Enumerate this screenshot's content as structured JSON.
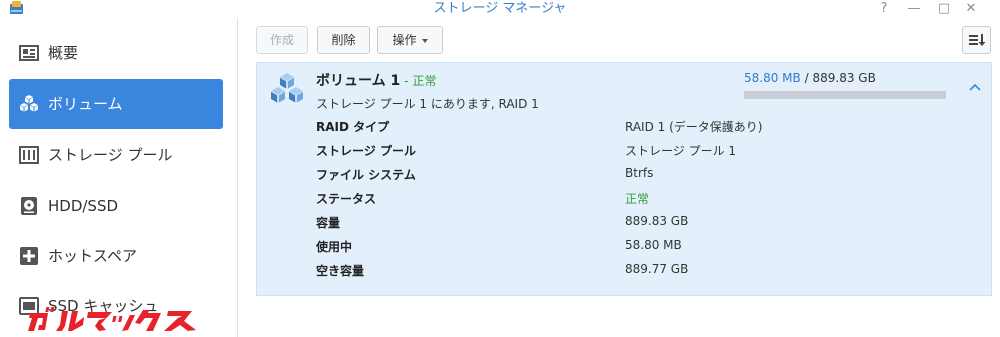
{
  "window": {
    "title": "ストレージ マネージャ",
    "buttons": [
      "?",
      "—",
      "□",
      "✕"
    ]
  },
  "sidebar": {
    "items": [
      {
        "label": "概要",
        "icon": "overview-icon"
      },
      {
        "label": "ボリューム",
        "icon": "volume-icon",
        "active": true
      },
      {
        "label": "ストレージ プール",
        "icon": "storage-pool-icon"
      },
      {
        "label": "HDD/SSD",
        "icon": "hdd-icon"
      },
      {
        "label": "ホットスペア",
        "icon": "hot-spare-icon"
      },
      {
        "label": "SSD キャッシュ",
        "icon": "ssd-cache-icon"
      }
    ]
  },
  "toolbar": {
    "create_label": "作成",
    "delete_label": "削除",
    "action_label": "操作",
    "sort_icon": "sort-icon"
  },
  "volume": {
    "name": "ボリューム 1",
    "separator": "-",
    "status": "正常",
    "subtitle": "ストレージ プール 1 にあります, RAID 1",
    "used": "58.80 MB",
    "usage_sep": "/",
    "total": "889.83 GB",
    "usage_fraction": 0.0001,
    "details": [
      {
        "label": "RAID タイプ",
        "value": "RAID 1 (データ保護あり)"
      },
      {
        "label": "ストレージ プール",
        "value": "ストレージ プール 1"
      },
      {
        "label": "ファイル システム",
        "value": "Btrfs"
      },
      {
        "label": "ステータス",
        "value": "正常",
        "ok": true
      },
      {
        "label": "容量",
        "value": "889.83 GB"
      },
      {
        "label": "使用中",
        "value": "58.80 MB"
      },
      {
        "label": "空き容量",
        "value": "889.77 GB"
      }
    ]
  },
  "watermark": {
    "text": "ガルマックス",
    "color": "#e8222b"
  },
  "colors": {
    "accent": "#3a86de",
    "title": "#3a7cc8",
    "ok": "#3a9a3a",
    "panel": "#e3f0fc"
  }
}
